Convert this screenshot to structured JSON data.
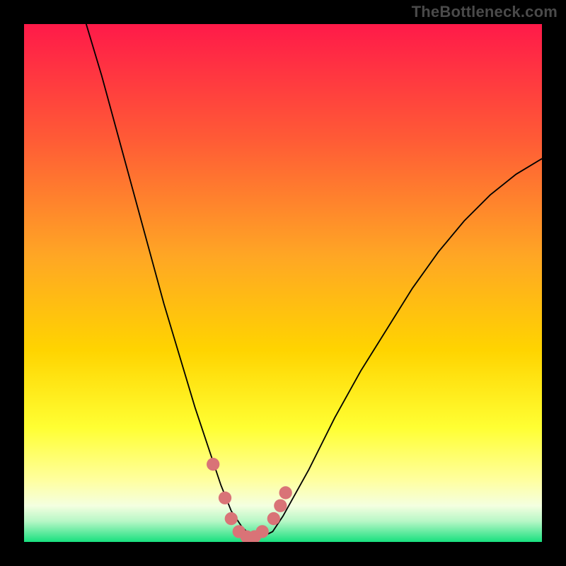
{
  "watermark": "TheBottleneck.com",
  "colors": {
    "frame": "#000000",
    "gradient_top": "#ff1a49",
    "gradient_mid_upper": "#ff7a2b",
    "gradient_mid": "#ffd400",
    "gradient_lower": "#ffff6b",
    "gradient_bottom_pale": "#f4ffe0",
    "gradient_bottom": "#18e07e",
    "curve": "#000000",
    "markers": "#d97377"
  },
  "chart_data": {
    "type": "line",
    "title": "",
    "xlabel": "",
    "ylabel": "",
    "xlim": [
      0,
      100
    ],
    "ylim": [
      0,
      100
    ],
    "grid": false,
    "legend": false,
    "series": [
      {
        "name": "bottleneck-curve",
        "x": [
          12,
          15,
          18,
          21,
          24,
          27,
          30,
          33,
          36,
          38,
          40,
          42,
          44,
          46,
          48,
          50,
          55,
          60,
          65,
          70,
          75,
          80,
          85,
          90,
          95,
          100
        ],
        "y": [
          100,
          90,
          79,
          68,
          57,
          46,
          36,
          26,
          17,
          11,
          6,
          3,
          1,
          1,
          2,
          5,
          14,
          24,
          33,
          41,
          49,
          56,
          62,
          67,
          71,
          74
        ]
      }
    ],
    "markers": {
      "name": "highlight-dots",
      "x": [
        36.5,
        38.8,
        40.0,
        41.5,
        43.0,
        44.5,
        46.0,
        48.2,
        49.5,
        50.5
      ],
      "y": [
        15.0,
        8.5,
        4.5,
        2.0,
        1.0,
        1.0,
        2.0,
        4.5,
        7.0,
        9.5
      ]
    }
  }
}
